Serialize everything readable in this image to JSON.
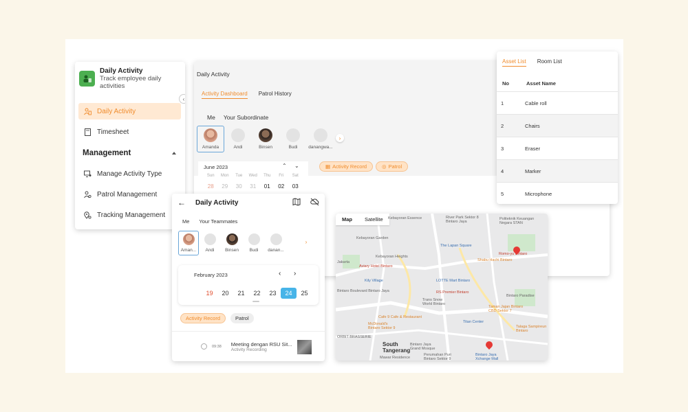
{
  "sidebar": {
    "app_title": "Daily Activity",
    "app_subtitle": "Track employee daily activities",
    "items": [
      {
        "label": "Daily Activity"
      },
      {
        "label": "Timesheet"
      }
    ],
    "section": "Management",
    "management_items": [
      {
        "label": "Manage Activity Type"
      },
      {
        "label": "Patrol Management"
      },
      {
        "label": "Tracking Management"
      }
    ],
    "accent": "#f08c2d"
  },
  "desktop": {
    "title": "Daily Activity",
    "tabs": [
      "Activity Dashboard",
      "Patrol History"
    ],
    "segments": [
      "Me",
      "Your Subordinate"
    ],
    "people": [
      "Amanda",
      "Andi",
      "Binsen",
      "Budi",
      "danangwa..."
    ],
    "calendar": {
      "month": "June 2023",
      "weekdays": [
        "Sun",
        "Mon",
        "Tue",
        "Wed",
        "Thu",
        "Fri",
        "Sat"
      ],
      "days": [
        "28",
        "29",
        "30",
        "31",
        "01",
        "02",
        "03"
      ]
    },
    "pills": [
      "Activity Record",
      "Patrol"
    ]
  },
  "assets": {
    "tabs": [
      "Asset List",
      "Room List"
    ],
    "columns": [
      "No",
      "Asset Name"
    ],
    "rows": [
      {
        "no": "1",
        "name": "Cable roll"
      },
      {
        "no": "2",
        "name": "Chairs"
      },
      {
        "no": "3",
        "name": "Eraser"
      },
      {
        "no": "4",
        "name": "Marker"
      },
      {
        "no": "5",
        "name": "Microphone"
      }
    ]
  },
  "mobile": {
    "title": "Daily Activity",
    "segments": [
      "Me",
      "Your Teammates"
    ],
    "people": [
      "Aman...",
      "Andi",
      "Binsen",
      "Budi",
      "danan..."
    ],
    "month": "February 2023",
    "days": [
      "19",
      "20",
      "21",
      "22",
      "23",
      "24",
      "25"
    ],
    "selected_day": "24",
    "pills": [
      "Activity Record",
      "Patrol"
    ],
    "item": {
      "time": "09:38",
      "title": "Meeting dengan RSU Sit...",
      "subtitle": "Activity Recording"
    }
  },
  "map": {
    "types": [
      "Map",
      "Satellite"
    ],
    "labels": {
      "kebayoran_essence": "Kebayoran Essence",
      "river_park": "River Park Sektor 8\nBintaro Jaya",
      "politeknik": "Politeknik Keuangan\nNegara STAN",
      "kebayoran_garden": "Kebayoran Garden",
      "lapan_square": "The Lapan Square",
      "romoyu": "Romo-yu Bintaro",
      "kebayoran_heights": "Kebayoran Heights",
      "jakarta": "Jakarta",
      "aviary": "Aviary Hotel Bintaro",
      "shabu": "Shabu Hachi Bintaro",
      "lotte": "LOTTE Mart Bintaro",
      "kily": "Kily Village",
      "boulevard": "Bintaro Boulevard Bintaro Jaya",
      "rs_premier": "RS Premier Bintaro",
      "trans_snow": "Trans Snow\nWorld Bintaro",
      "taman_jajan": "Taman Jajan Bintaro\nCBD Sektor 7",
      "bintaro_paradise": "Bintaro Paradise",
      "cafe9": "Cafe 9 Cafe & Restaurant",
      "mcd": "McDonald's\nBintaro Sektor 9",
      "titan": "Titan Center",
      "talaga": "Talaga Sampireun\nBintaro",
      "orbit": "ORBIT BRASSERIE",
      "south_tangerang": "South\nTangerang",
      "bintaro_jaya_grand": "Bintaro Jaya\nGrand Mosque",
      "mawar": "Mawar Residence",
      "perumahan_puri": "Perumahan Puri\nBintaro Sektor 9",
      "xchange": "Bintaro Jaya\nXchange Mall"
    }
  }
}
